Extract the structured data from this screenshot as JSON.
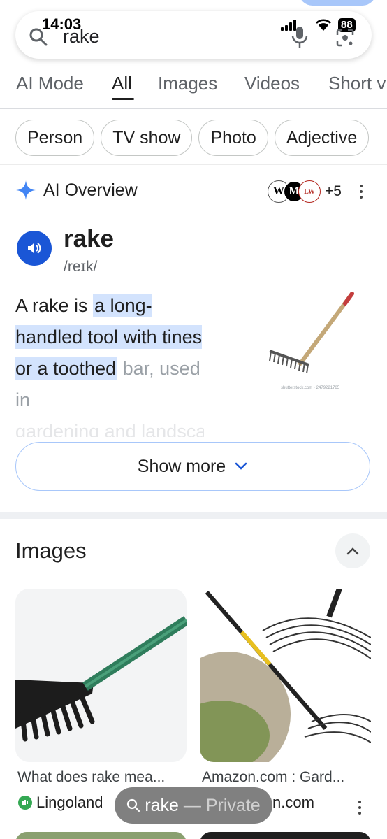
{
  "status_bar": {
    "time": "14:03",
    "battery": "88"
  },
  "search": {
    "query": "rake"
  },
  "tabs": [
    {
      "label": "AI Mode"
    },
    {
      "label": "All",
      "active": true
    },
    {
      "label": "Images"
    },
    {
      "label": "Videos"
    },
    {
      "label": "Short v"
    }
  ],
  "chips": [
    {
      "label": "Person"
    },
    {
      "label": "TV show"
    },
    {
      "label": "Photo"
    },
    {
      "label": "Adjective"
    }
  ],
  "ai_overview": {
    "title": "AI Overview",
    "sources_more": "+5",
    "source_logos": [
      "W",
      "M",
      "LW"
    ],
    "word": "rake",
    "pronunciation": "/reɪk/",
    "definition": {
      "prefix": "A rake is ",
      "highlight": "a long-handled tool with tines or a toothed",
      "rest": " bar, used in",
      "faded": "gardening and landscaping to"
    },
    "image_caption": "shutterstock.com · 2479221765",
    "show_more": "Show more"
  },
  "images_section": {
    "title": "Images",
    "results": [
      {
        "caption": "What does rake mea...",
        "source": "Lingoland"
      },
      {
        "caption": "Amazon.com : Gard...",
        "source": "n.com"
      }
    ]
  },
  "private_pill": {
    "query": "rake",
    "separator": " — ",
    "mode": "Private"
  },
  "colors": {
    "accent": "#1a56d6",
    "highlight": "#d3e3fd",
    "outline": "#a8c7fa"
  }
}
